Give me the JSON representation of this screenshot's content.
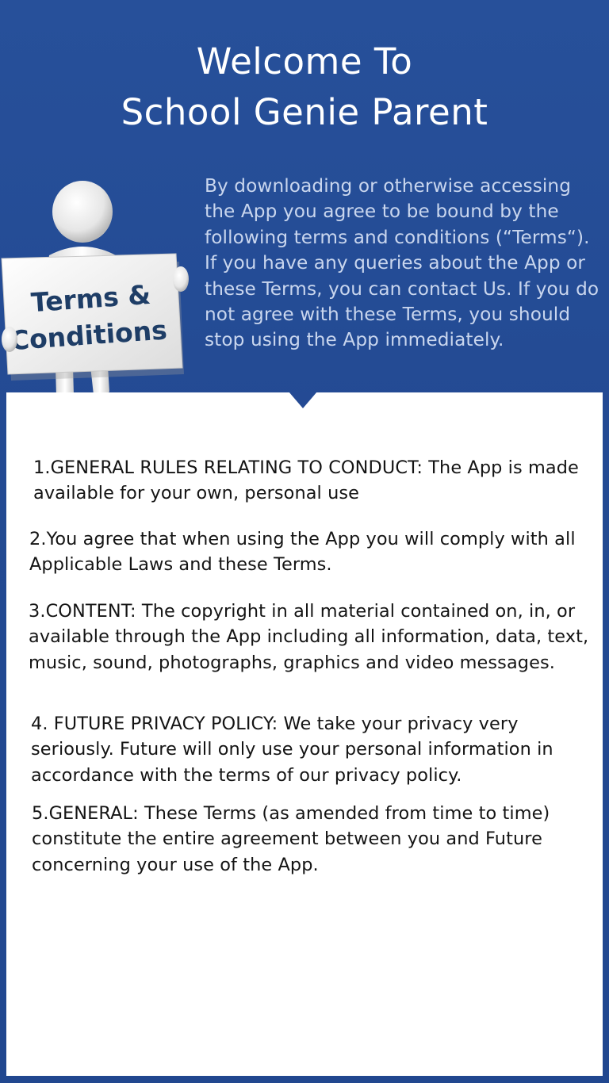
{
  "header": {
    "title_line1": "Welcome To",
    "title_line2": "School Genie Parent"
  },
  "intro": {
    "text": "By downloading or otherwise accessing the App you agree to be bound by the following terms and conditions (“Terms“). If you have any queries about the App or these Terms, you can contact Us. If you do not agree with these Terms, you should stop using the App immediately."
  },
  "illustration": {
    "sign_line1": "Terms &",
    "sign_line2": "Conditions",
    "icon": "person-holding-sign-icon"
  },
  "terms": [
    {
      "text": "1.GENERAL RULES RELATING TO CONDUCT: The App is made available for your own, personal use"
    },
    {
      "text": "2.You agree that when using the App you will comply with all Applicable Laws and these Terms."
    },
    {
      "text": "3.CONTENT: The copyright in all material contained on, in, or available through the App including all information, data, text, music, sound, photographs, graphics and video messages."
    },
    {
      "text": "4. FUTURE PRIVACY POLICY: We take your privacy very seriously. Future will only use your personal information in accordance with the terms of our privacy policy."
    },
    {
      "text": "5.GENERAL: These Terms (as amended from time to time) constitute the entire agreement between you and Future concerning your use of the App."
    }
  ],
  "colors": {
    "background": "#244a94",
    "intro_text": "#c9d6ee",
    "panel": "#ffffff",
    "body_text": "#141414"
  }
}
